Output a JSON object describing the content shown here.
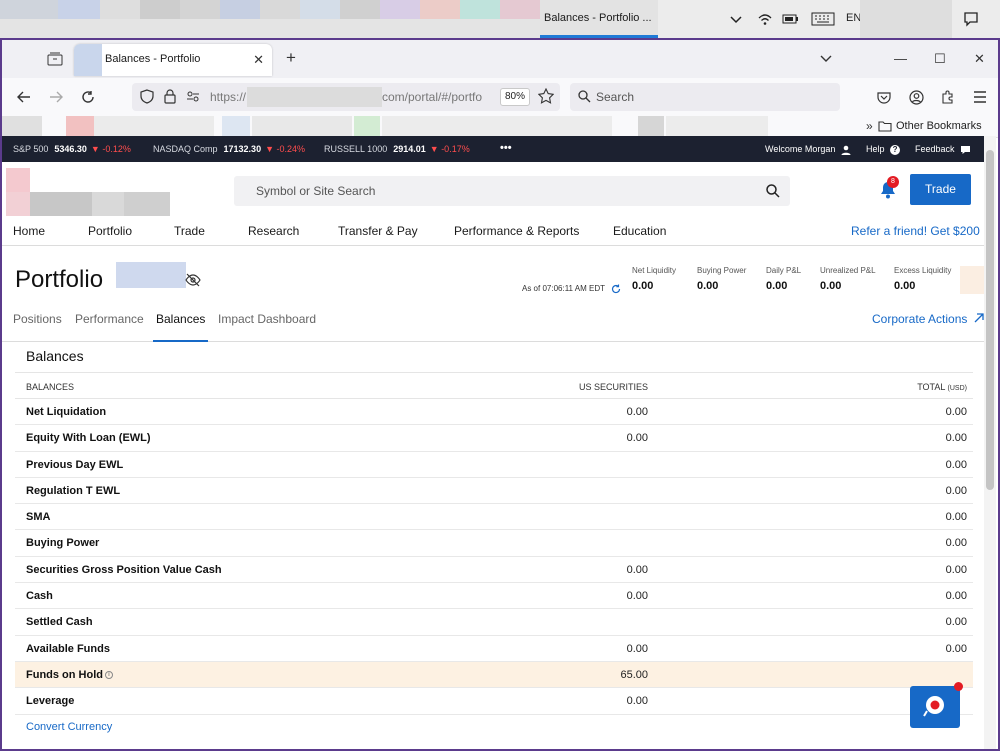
{
  "taskbar": {
    "active_window": "Balances - Portfolio ...",
    "language": "EN",
    "icons": [
      "chevron-down-icon",
      "wifi-icon",
      "battery-icon",
      "keyboard-icon",
      "notification-icon"
    ]
  },
  "browser": {
    "tab_title": "Balances - Portfolio",
    "url_prefix": "https://",
    "url_suffix": "com/portal/#/portfo",
    "zoom": "80%",
    "search_placeholder": "Search",
    "other_bookmarks": "Other Bookmarks"
  },
  "ticker": [
    {
      "name": "S&P 500",
      "value": "5346.30",
      "change": "-0.12%"
    },
    {
      "name": "NASDAQ Comp",
      "value": "17132.30",
      "change": "-0.24%"
    },
    {
      "name": "RUSSELL 1000",
      "value": "2914.01",
      "change": "-0.17%"
    }
  ],
  "ticker_more": "•••",
  "ticker_right": {
    "welcome": "Welcome Morgan",
    "help": "Help",
    "feedback": "Feedback"
  },
  "header": {
    "search_placeholder": "Symbol or Site Search",
    "notification_count": "8",
    "trade_label": "Trade"
  },
  "main_nav": [
    "Home",
    "Portfolio",
    "Trade",
    "Research",
    "Transfer & Pay",
    "Performance & Reports",
    "Education"
  ],
  "refer": "Refer a friend! Get $200",
  "portfolio": {
    "title": "Portfolio",
    "as_of": "As of 07:06:11 AM EDT",
    "metrics": [
      {
        "label": "Net Liquidity",
        "value": "0.00"
      },
      {
        "label": "Buying Power",
        "value": "0.00"
      },
      {
        "label": "Daily P&L",
        "value": "0.00"
      },
      {
        "label": "Unrealized P&L",
        "value": "0.00"
      },
      {
        "label": "Excess Liquidity",
        "value": "0.00"
      }
    ]
  },
  "subtabs": [
    "Positions",
    "Performance",
    "Balances",
    "Impact Dashboard"
  ],
  "active_subtab": "Balances",
  "corporate_actions": "Corporate Actions",
  "balances": {
    "title": "Balances",
    "headers": {
      "label": "BALANCES",
      "us": "US SECURITIES",
      "total": "TOTAL",
      "total_unit": "(USD)"
    },
    "rows": [
      {
        "label": "Net Liquidation",
        "us": "0.00",
        "total": "0.00"
      },
      {
        "label": "Equity With Loan (EWL)",
        "us": "0.00",
        "total": "0.00"
      },
      {
        "label": "Previous Day EWL",
        "us": "",
        "total": "0.00"
      },
      {
        "label": "Regulation T EWL",
        "us": "",
        "total": "0.00"
      },
      {
        "label": "SMA",
        "us": "",
        "total": "0.00"
      },
      {
        "label": "Buying Power",
        "us": "",
        "total": "0.00"
      },
      {
        "label": "Securities Gross Position Value Cash",
        "us": "0.00",
        "total": "0.00"
      },
      {
        "label": "Cash",
        "us": "0.00",
        "total": "0.00"
      },
      {
        "label": "Settled Cash",
        "us": "",
        "total": "0.00"
      },
      {
        "label": "Available Funds",
        "us": "0.00",
        "total": "0.00"
      },
      {
        "label": "Funds on Hold",
        "us": "65.00",
        "total": "",
        "info": true,
        "highlight": true
      },
      {
        "label": "Leverage",
        "us": "0.00",
        "total": ""
      }
    ],
    "convert_currency": "Convert Currency"
  },
  "colors": {
    "accent": "#1769c7",
    "ticker_bg": "#1c2130",
    "negative": "#ff4d4d",
    "hold_bg": "#fdf1e2",
    "badge": "#e31b23"
  }
}
